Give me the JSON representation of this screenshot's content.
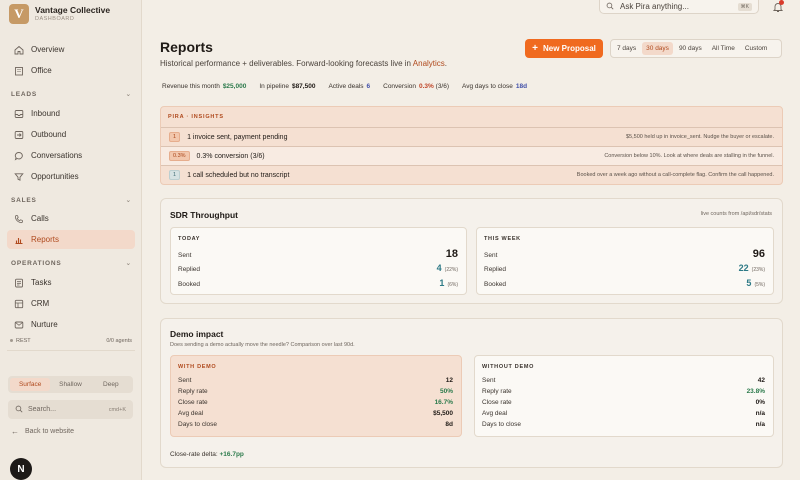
{
  "brand": {
    "logo": "V",
    "name": "Vantage Collective",
    "sub": "DASHBOARD"
  },
  "nav": {
    "top": [
      {
        "label": "Overview",
        "icon": "home-icon"
      },
      {
        "label": "Office",
        "icon": "building-icon"
      }
    ],
    "leads_label": "LEADS",
    "leads": [
      {
        "label": "Inbound",
        "icon": "inbox-icon"
      },
      {
        "label": "Outbound",
        "icon": "send-icon"
      },
      {
        "label": "Conversations",
        "icon": "chat-icon"
      },
      {
        "label": "Opportunities",
        "icon": "filter-icon"
      }
    ],
    "sales_label": "SALES",
    "sales": [
      {
        "label": "Calls",
        "icon": "phone-icon"
      },
      {
        "label": "Reports",
        "icon": "chart-icon",
        "active": true
      }
    ],
    "operations_label": "OPERATIONS",
    "operations": [
      {
        "label": "Tasks",
        "icon": "list-icon"
      },
      {
        "label": "CRM",
        "icon": "grid-icon"
      },
      {
        "label": "Nurture",
        "icon": "mail-icon"
      }
    ]
  },
  "sidebar_status": {
    "left": "REST",
    "right": "0/0 agents"
  },
  "depth": {
    "options": [
      "Surface",
      "Shallow",
      "Deep"
    ],
    "selected": "Surface"
  },
  "side_search": {
    "placeholder": "Search...",
    "shortcut": "cmd+K"
  },
  "back": "Back to website",
  "avatar": "N",
  "topbar": {
    "ask_placeholder": "Ask Pira anything...",
    "ask_shortcut": "⌘K"
  },
  "page": {
    "title": "Reports",
    "subtitle": "Historical performance + deliverables. Forward-looking forecasts live in",
    "subtitle_link": "Analytics",
    "subtitle_end": ".",
    "new_button": "New Proposal",
    "ranges": [
      "7 days",
      "30 days",
      "90 days",
      "All Time",
      "Custom"
    ],
    "selected_range": "30 days"
  },
  "stats": [
    {
      "label": "Revenue this month",
      "value": "$25,000",
      "color": "green"
    },
    {
      "label": "In pipeline",
      "value": "$87,500",
      "color": "dark"
    },
    {
      "label": "Active deals",
      "value": "6",
      "color": "blue"
    },
    {
      "label": "Conversion",
      "value": "0.3%",
      "extra": "(3/6)",
      "color": "red"
    },
    {
      "label": "Avg days to close",
      "value": "18d",
      "color": "blue"
    }
  ],
  "insights": {
    "title": "PIRA · INSIGHTS",
    "rows": [
      {
        "badge": "1",
        "kind": "warn",
        "text": "1 invoice sent, payment pending",
        "note": "$5,500 held up in invoice_sent. Nudge the buyer or escalate."
      },
      {
        "badge": "0.3%",
        "kind": "warn",
        "text": "0.3% conversion (3/6)",
        "note": "Conversion below 10%. Look at where deals are stalling in the funnel."
      },
      {
        "badge": "1",
        "kind": "info",
        "text": "1 call scheduled but no transcript",
        "note": "Booked over a week ago without a call-complete flag. Confirm the call happened."
      }
    ]
  },
  "sdr": {
    "title": "SDR Throughput",
    "hint": "live counts from /api/sdr/stats",
    "today": {
      "label": "TODAY",
      "sent_label": "Sent",
      "sent": "18",
      "replied_label": "Replied",
      "replied": "4",
      "replied_pct": "(22%)",
      "booked_label": "Booked",
      "booked": "1",
      "booked_pct": "(6%)"
    },
    "week": {
      "label": "THIS WEEK",
      "sent_label": "Sent",
      "sent": "96",
      "replied_label": "Replied",
      "replied": "22",
      "replied_pct": "(23%)",
      "booked_label": "Booked",
      "booked": "5",
      "booked_pct": "(5%)"
    }
  },
  "demo": {
    "title": "Demo impact",
    "hint": "Does sending a demo actually move the needle? Comparison over last 90d.",
    "with": {
      "label": "WITH DEMO",
      "rows": [
        {
          "label": "Sent",
          "value": "12",
          "color": "dark"
        },
        {
          "label": "Reply rate",
          "value": "50%",
          "color": "green"
        },
        {
          "label": "Close rate",
          "value": "16.7%",
          "color": "green"
        },
        {
          "label": "Avg deal",
          "value": "$5,500",
          "color": "dark"
        },
        {
          "label": "Days to close",
          "value": "8d",
          "color": "dark"
        }
      ]
    },
    "without": {
      "label": "WITHOUT DEMO",
      "rows": [
        {
          "label": "Sent",
          "value": "42",
          "color": "dark"
        },
        {
          "label": "Reply rate",
          "value": "23.8%",
          "color": "green"
        },
        {
          "label": "Close rate",
          "value": "0%",
          "color": "dark"
        },
        {
          "label": "Avg deal",
          "value": "n/a",
          "color": "dark"
        },
        {
          "label": "Days to close",
          "value": "n/a",
          "color": "dark"
        }
      ]
    },
    "delta_label": "Close-rate delta:",
    "delta_value": "+16.7pp"
  },
  "colors": {
    "accent": "#f06a1f",
    "accent_text": "#b04a1e",
    "green": "#2b7a4b",
    "teal": "#2e7a86"
  }
}
